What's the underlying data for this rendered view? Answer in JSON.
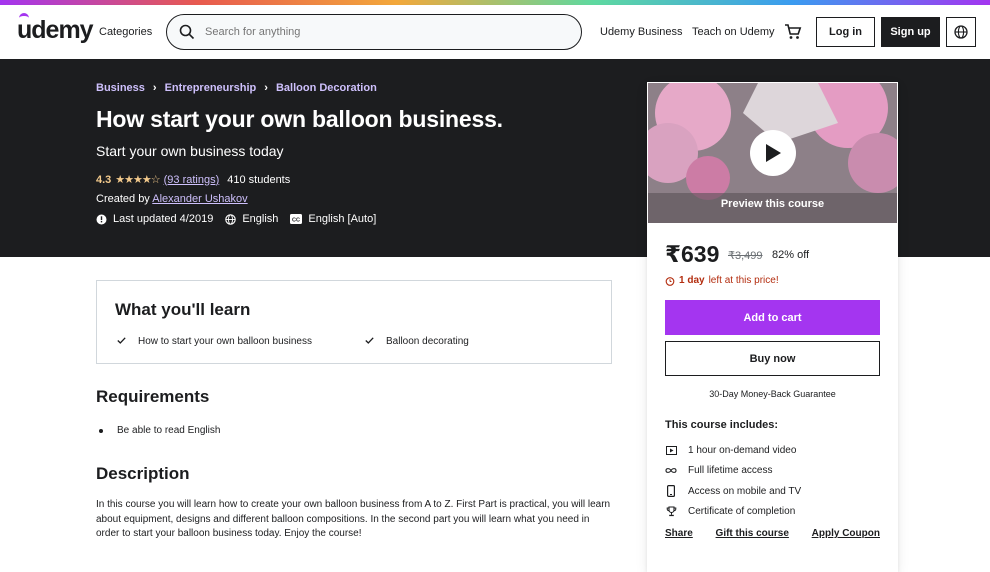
{
  "header": {
    "logo_text": "udemy",
    "categories_label": "Categories",
    "search_placeholder": "Search for anything",
    "business_link": "Udemy Business",
    "teach_link": "Teach on Udemy",
    "login_label": "Log in",
    "signup_label": "Sign up",
    "accent_color": "#a435f0"
  },
  "breadcrumbs": [
    "Business",
    "Entrepreneurship",
    "Balloon Decoration"
  ],
  "course": {
    "title": "How start your own balloon business.",
    "subtitle": "Start your own business today",
    "rating": "4.3",
    "stars": 4.3,
    "ratings_count": "(93 ratings)",
    "students": "410 students",
    "created_prefix": "Created by",
    "instructor": "Alexander Ushakov",
    "last_updated": "Last updated 4/2019",
    "language": "English",
    "captions": "English [Auto]"
  },
  "sidebar": {
    "preview_label": "Preview this course",
    "price": "₹639",
    "original_price": "₹3,499",
    "discount": "82% off",
    "timer_bold": "1 day",
    "timer_rest": "left at this price!",
    "add_to_cart": "Add to cart",
    "buy_now": "Buy now",
    "guarantee": "30-Day Money-Back Guarantee",
    "includes_heading": "This course includes:",
    "includes": [
      {
        "icon": "video-icon",
        "label": "1 hour on-demand video"
      },
      {
        "icon": "infinity-icon",
        "label": "Full lifetime access"
      },
      {
        "icon": "mobile-icon",
        "label": "Access on mobile and TV"
      },
      {
        "icon": "trophy-icon",
        "label": "Certificate of completion"
      }
    ],
    "links": {
      "share": "Share",
      "gift": "Gift this course",
      "coupon": "Apply Coupon"
    }
  },
  "learn": {
    "heading": "What you'll learn",
    "items": [
      "How to start your own balloon business",
      "Balloon decorating"
    ]
  },
  "requirements": {
    "heading": "Requirements",
    "items": [
      "Be able to read English"
    ]
  },
  "description": {
    "heading": "Description",
    "text": "In this course you will learn how to create your own balloon business from A to Z. First Part is practical, you will learn about equipment, designs and different balloon compositions. In the second part you will learn what you need in order to start your balloon business today. Enjoy the course!"
  }
}
